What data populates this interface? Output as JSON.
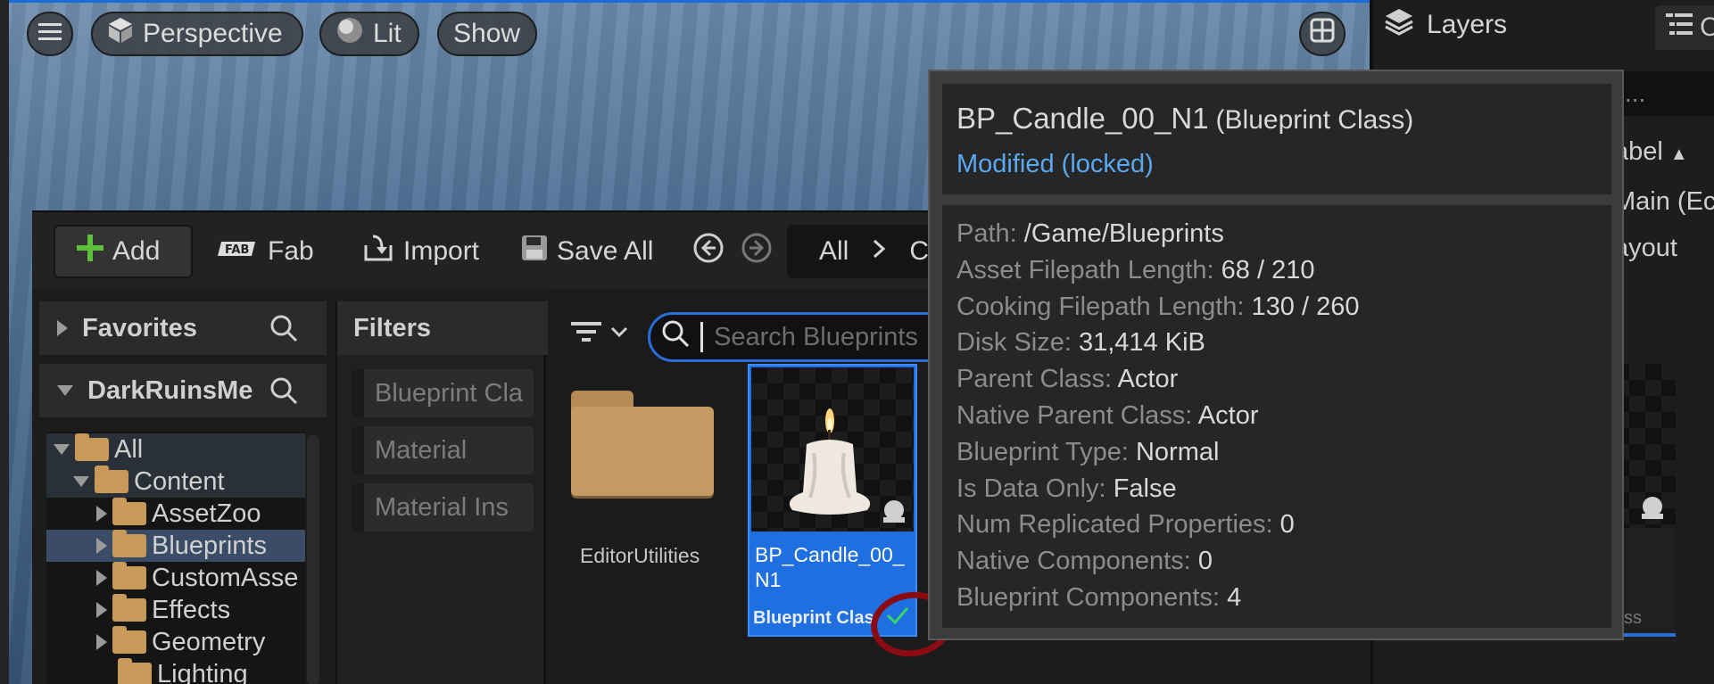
{
  "viewport": {
    "menu_icon": "hamburger-icon",
    "perspective_label": "Perspective",
    "lit_label": "Lit",
    "show_label": "Show",
    "layout_icon": "grid-icon"
  },
  "right_panel": {
    "layers_label": "Layers",
    "outliner_tab_text": "C",
    "search_text": "...",
    "label_header": "abel",
    "row_text": "Main (Ec",
    "layout_text": "ayout"
  },
  "toolbar": {
    "add_label": "Add",
    "fab_label": "Fab",
    "import_label": "Import",
    "save_all_label": "Save All",
    "breadcrumb_root": "All",
    "breadcrumb_next": "C"
  },
  "favorites": {
    "label": "Favorites"
  },
  "project": {
    "label": "DarkRuinsMe"
  },
  "tree": [
    {
      "label": "All"
    },
    {
      "label": "Content"
    },
    {
      "label": "AssetZoo"
    },
    {
      "label": "Blueprints"
    },
    {
      "label": "CustomAsse"
    },
    {
      "label": "Effects"
    },
    {
      "label": "Geometry"
    },
    {
      "label": "Lighting"
    }
  ],
  "filters": {
    "title": "Filters",
    "chips": [
      "Blueprint Cla",
      "Material",
      "Material Ins"
    ]
  },
  "search": {
    "placeholder": "Search Blueprints"
  },
  "assets": {
    "folder_label": "EditorUtilities",
    "tile_name": "BP_Candle_00_N1",
    "tile_type": "Blueprint Clas",
    "tile2_type": "ss"
  },
  "tooltip": {
    "name": "BP_Candle_00_N1",
    "class": "(Blueprint Class)",
    "status": "Modified (locked)",
    "rows": [
      {
        "k": "Path:",
        "v": "/Game/Blueprints"
      },
      {
        "k": "Asset Filepath Length:",
        "v": "68 / 210"
      },
      {
        "k": "Cooking Filepath Length:",
        "v": "130 / 260"
      },
      {
        "k": "Disk Size:",
        "v": "31,414 KiB"
      },
      {
        "k": "Parent Class:",
        "v": "Actor"
      },
      {
        "k": "Native Parent Class:",
        "v": "Actor"
      },
      {
        "k": "Blueprint Type:",
        "v": "Normal"
      },
      {
        "k": "Is Data Only:",
        "v": "False"
      },
      {
        "k": "Num Replicated Properties:",
        "v": "0"
      },
      {
        "k": "Native Components:",
        "v": "0"
      },
      {
        "k": "Blueprint Components:",
        "v": "4"
      }
    ]
  },
  "colors": {
    "accent": "#1f6fe0",
    "status_link": "#5aa9f0",
    "folder": "#c59b64",
    "annotation": "#8a0b12",
    "check": "#38d66b"
  }
}
